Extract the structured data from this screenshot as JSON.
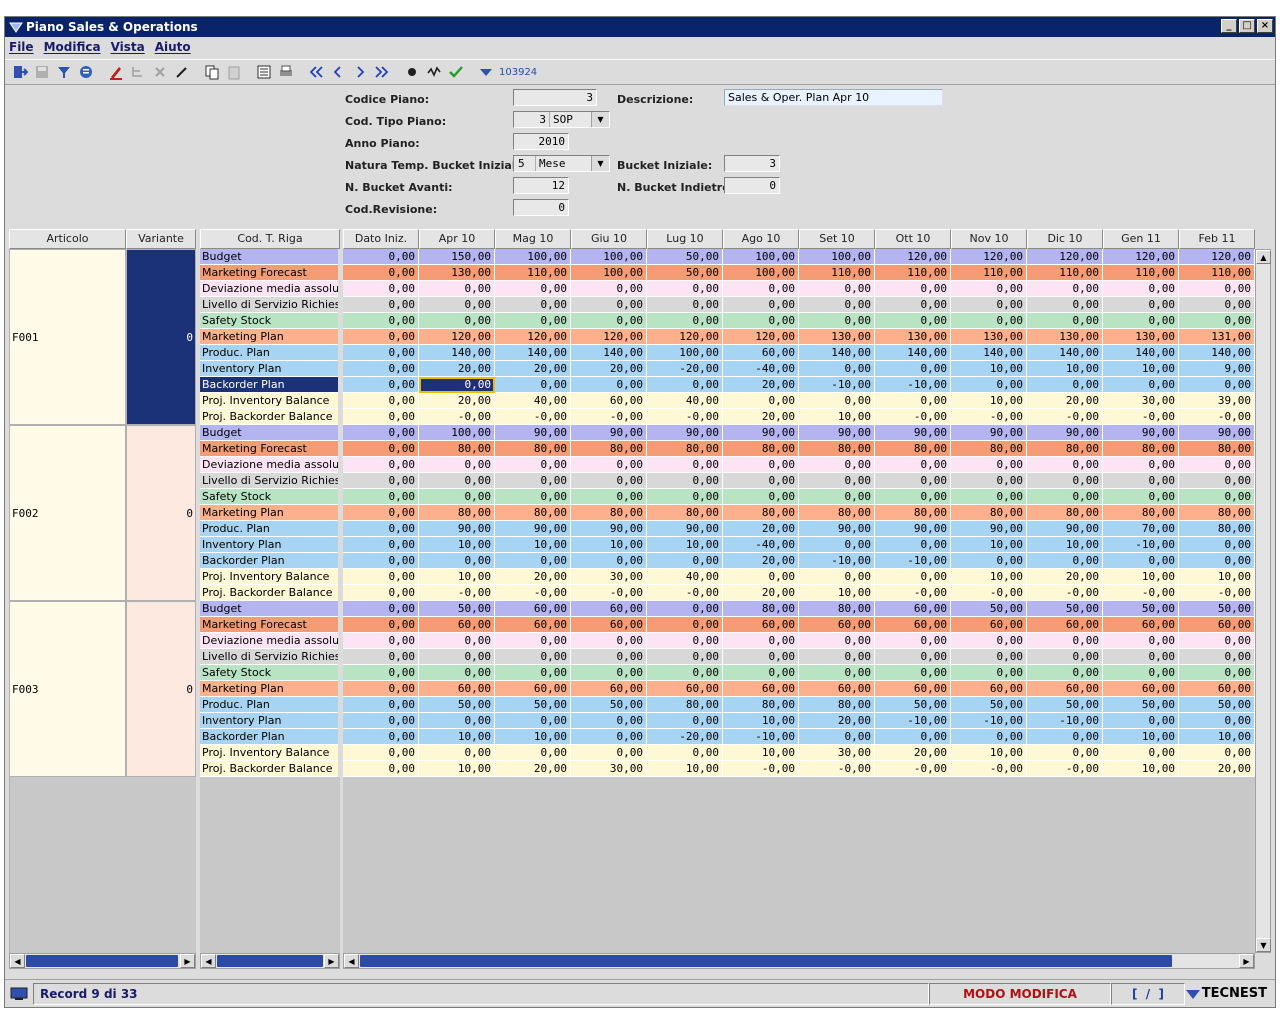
{
  "window": {
    "title": "Piano Sales & Operations"
  },
  "menu": [
    {
      "label": "File"
    },
    {
      "label": "Modifica"
    },
    {
      "label": "Vista"
    },
    {
      "label": "Aiuto"
    }
  ],
  "toolbar": {
    "record_id": "103924"
  },
  "form": {
    "codice_piano": {
      "label": "Codice Piano:",
      "value": "3"
    },
    "descrizione": {
      "label": "Descrizione:",
      "value": "Sales & Oper. Plan Apr 10"
    },
    "cod_tipo_piano": {
      "label": "Cod. Tipo Piano:",
      "code": "3",
      "value": "SOP"
    },
    "anno_piano": {
      "label": "Anno Piano:",
      "value": "2010"
    },
    "natura_temp": {
      "label": "Natura Temp. Bucket Iniziale:",
      "code": "5",
      "value": "Mese"
    },
    "bucket_iniziale": {
      "label": "Bucket Iniziale:",
      "value": "3"
    },
    "n_bucket_avanti": {
      "label": "N. Bucket Avanti:",
      "value": "12"
    },
    "n_bucket_indietro": {
      "label": "N. Bucket Indietro:",
      "value": "0"
    },
    "cod_revisione": {
      "label": "Cod.Revisione:",
      "value": "0"
    }
  },
  "grid": {
    "left_headers": {
      "articolo": "Articolo",
      "variante": "Variante",
      "cod_riga": "Cod. T. Riga"
    },
    "columns": [
      "Dato Iniz.",
      "Apr 10",
      "Mag 10",
      "Giu 10",
      "Lug 10",
      "Ago 10",
      "Set 10",
      "Ott 10",
      "Nov 10",
      "Dic 10",
      "Gen 11",
      "Feb 11"
    ],
    "row_colors": {
      "Budget": "#b4b4f0",
      "Marketing Forecast": "#f59c74",
      "Deviazione media assoluta": "#fce4f4",
      "Livello di Servizio Richiesto": "#d8d8d8",
      "Safety Stock": "#b8e4c4",
      "Marketing Plan": "#fcb08c",
      "Produc. Plan": "#a8d4f4",
      "Inventory Plan": "#a8d4f4",
      "Backorder Plan": "#a8d4f4",
      "Proj. Inventory Balance": "#fff8d4",
      "Proj. Backorder Balance": "#fff8d4"
    },
    "selected_color": "#1c3278",
    "articles": [
      {
        "code": "F001",
        "variant": "0",
        "rows": [
          {
            "label": "Budget",
            "values": [
              "0,00",
              "150,00",
              "100,00",
              "100,00",
              "50,00",
              "100,00",
              "100,00",
              "120,00",
              "120,00",
              "120,00",
              "120,00",
              "120,00"
            ]
          },
          {
            "label": "Marketing Forecast",
            "values": [
              "0,00",
              "130,00",
              "110,00",
              "100,00",
              "50,00",
              "100,00",
              "110,00",
              "110,00",
              "110,00",
              "110,00",
              "110,00",
              "110,00"
            ]
          },
          {
            "label": "Deviazione media assoluta",
            "values": [
              "0,00",
              "0,00",
              "0,00",
              "0,00",
              "0,00",
              "0,00",
              "0,00",
              "0,00",
              "0,00",
              "0,00",
              "0,00",
              "0,00"
            ]
          },
          {
            "label": "Livello di Servizio Richiesto",
            "values": [
              "0,00",
              "0,00",
              "0,00",
              "0,00",
              "0,00",
              "0,00",
              "0,00",
              "0,00",
              "0,00",
              "0,00",
              "0,00",
              "0,00"
            ]
          },
          {
            "label": "Safety Stock",
            "values": [
              "0,00",
              "0,00",
              "0,00",
              "0,00",
              "0,00",
              "0,00",
              "0,00",
              "0,00",
              "0,00",
              "0,00",
              "0,00",
              "0,00"
            ]
          },
          {
            "label": "Marketing Plan",
            "values": [
              "0,00",
              "120,00",
              "120,00",
              "120,00",
              "120,00",
              "120,00",
              "130,00",
              "130,00",
              "130,00",
              "130,00",
              "130,00",
              "131,00"
            ]
          },
          {
            "label": "Produc. Plan",
            "values": [
              "0,00",
              "140,00",
              "140,00",
              "140,00",
              "100,00",
              "60,00",
              "140,00",
              "140,00",
              "140,00",
              "140,00",
              "140,00",
              "140,00"
            ]
          },
          {
            "label": "Inventory Plan",
            "values": [
              "0,00",
              "20,00",
              "20,00",
              "20,00",
              "-20,00",
              "-40,00",
              "0,00",
              "0,00",
              "10,00",
              "10,00",
              "10,00",
              "9,00"
            ]
          },
          {
            "label": "Backorder Plan",
            "values": [
              "0,00",
              "0,00",
              "0,00",
              "0,00",
              "0,00",
              "20,00",
              "-10,00",
              "-10,00",
              "0,00",
              "0,00",
              "0,00",
              "0,00"
            ]
          },
          {
            "label": "Proj. Inventory Balance",
            "values": [
              "0,00",
              "20,00",
              "40,00",
              "60,00",
              "40,00",
              "0,00",
              "0,00",
              "0,00",
              "10,00",
              "20,00",
              "30,00",
              "39,00"
            ]
          },
          {
            "label": "Proj. Backorder Balance",
            "values": [
              "0,00",
              "-0,00",
              "-0,00",
              "-0,00",
              "-0,00",
              "20,00",
              "10,00",
              "-0,00",
              "-0,00",
              "-0,00",
              "-0,00",
              "-0,00"
            ]
          }
        ]
      },
      {
        "code": "F002",
        "variant": "0",
        "rows": [
          {
            "label": "Budget",
            "values": [
              "0,00",
              "100,00",
              "90,00",
              "90,00",
              "90,00",
              "90,00",
              "90,00",
              "90,00",
              "90,00",
              "90,00",
              "90,00",
              "90,00"
            ]
          },
          {
            "label": "Marketing Forecast",
            "values": [
              "0,00",
              "80,00",
              "80,00",
              "80,00",
              "80,00",
              "80,00",
              "80,00",
              "80,00",
              "80,00",
              "80,00",
              "80,00",
              "80,00"
            ]
          },
          {
            "label": "Deviazione media assoluta",
            "values": [
              "0,00",
              "0,00",
              "0,00",
              "0,00",
              "0,00",
              "0,00",
              "0,00",
              "0,00",
              "0,00",
              "0,00",
              "0,00",
              "0,00"
            ]
          },
          {
            "label": "Livello di Servizio Richiesto",
            "values": [
              "0,00",
              "0,00",
              "0,00",
              "0,00",
              "0,00",
              "0,00",
              "0,00",
              "0,00",
              "0,00",
              "0,00",
              "0,00",
              "0,00"
            ]
          },
          {
            "label": "Safety Stock",
            "values": [
              "0,00",
              "0,00",
              "0,00",
              "0,00",
              "0,00",
              "0,00",
              "0,00",
              "0,00",
              "0,00",
              "0,00",
              "0,00",
              "0,00"
            ]
          },
          {
            "label": "Marketing Plan",
            "values": [
              "0,00",
              "80,00",
              "80,00",
              "80,00",
              "80,00",
              "80,00",
              "80,00",
              "80,00",
              "80,00",
              "80,00",
              "80,00",
              "80,00"
            ]
          },
          {
            "label": "Produc. Plan",
            "values": [
              "0,00",
              "90,00",
              "90,00",
              "90,00",
              "90,00",
              "20,00",
              "90,00",
              "90,00",
              "90,00",
              "90,00",
              "70,00",
              "80,00"
            ]
          },
          {
            "label": "Inventory Plan",
            "values": [
              "0,00",
              "10,00",
              "10,00",
              "10,00",
              "10,00",
              "-40,00",
              "0,00",
              "0,00",
              "10,00",
              "10,00",
              "-10,00",
              "0,00"
            ]
          },
          {
            "label": "Backorder Plan",
            "values": [
              "0,00",
              "0,00",
              "0,00",
              "0,00",
              "0,00",
              "20,00",
              "-10,00",
              "-10,00",
              "0,00",
              "0,00",
              "0,00",
              "0,00"
            ]
          },
          {
            "label": "Proj. Inventory Balance",
            "values": [
              "0,00",
              "10,00",
              "20,00",
              "30,00",
              "40,00",
              "0,00",
              "0,00",
              "0,00",
              "10,00",
              "20,00",
              "10,00",
              "10,00"
            ]
          },
          {
            "label": "Proj. Backorder Balance",
            "values": [
              "0,00",
              "-0,00",
              "-0,00",
              "-0,00",
              "-0,00",
              "20,00",
              "10,00",
              "-0,00",
              "-0,00",
              "-0,00",
              "-0,00",
              "-0,00"
            ]
          }
        ]
      },
      {
        "code": "F003",
        "variant": "0",
        "rows": [
          {
            "label": "Budget",
            "values": [
              "0,00",
              "50,00",
              "60,00",
              "60,00",
              "0,00",
              "80,00",
              "80,00",
              "60,00",
              "50,00",
              "50,00",
              "50,00",
              "50,00"
            ]
          },
          {
            "label": "Marketing Forecast",
            "values": [
              "0,00",
              "60,00",
              "60,00",
              "60,00",
              "0,00",
              "60,00",
              "60,00",
              "60,00",
              "60,00",
              "60,00",
              "60,00",
              "60,00"
            ]
          },
          {
            "label": "Deviazione media assoluta",
            "values": [
              "0,00",
              "0,00",
              "0,00",
              "0,00",
              "0,00",
              "0,00",
              "0,00",
              "0,00",
              "0,00",
              "0,00",
              "0,00",
              "0,00"
            ]
          },
          {
            "label": "Livello di Servizio Richiesto",
            "values": [
              "0,00",
              "0,00",
              "0,00",
              "0,00",
              "0,00",
              "0,00",
              "0,00",
              "0,00",
              "0,00",
              "0,00",
              "0,00",
              "0,00"
            ]
          },
          {
            "label": "Safety Stock",
            "values": [
              "0,00",
              "0,00",
              "0,00",
              "0,00",
              "0,00",
              "0,00",
              "0,00",
              "0,00",
              "0,00",
              "0,00",
              "0,00",
              "0,00"
            ]
          },
          {
            "label": "Marketing Plan",
            "values": [
              "0,00",
              "60,00",
              "60,00",
              "60,00",
              "60,00",
              "60,00",
              "60,00",
              "60,00",
              "60,00",
              "60,00",
              "60,00",
              "60,00"
            ]
          },
          {
            "label": "Produc. Plan",
            "values": [
              "0,00",
              "50,00",
              "50,00",
              "50,00",
              "80,00",
              "80,00",
              "80,00",
              "50,00",
              "50,00",
              "50,00",
              "50,00",
              "50,00"
            ]
          },
          {
            "label": "Inventory Plan",
            "values": [
              "0,00",
              "0,00",
              "0,00",
              "0,00",
              "0,00",
              "10,00",
              "20,00",
              "-10,00",
              "-10,00",
              "-10,00",
              "0,00",
              "0,00"
            ]
          },
          {
            "label": "Backorder Plan",
            "values": [
              "0,00",
              "10,00",
              "10,00",
              "0,00",
              "-20,00",
              "-10,00",
              "0,00",
              "0,00",
              "0,00",
              "0,00",
              "10,00",
              "10,00"
            ]
          },
          {
            "label": "Proj. Inventory Balance",
            "values": [
              "0,00",
              "0,00",
              "0,00",
              "0,00",
              "0,00",
              "10,00",
              "30,00",
              "20,00",
              "10,00",
              "0,00",
              "0,00",
              "0,00"
            ]
          },
          {
            "label": "Proj. Backorder Balance",
            "values": [
              "0,00",
              "10,00",
              "20,00",
              "30,00",
              "10,00",
              "-0,00",
              "-0,00",
              "-0,00",
              "-0,00",
              "-0,00",
              "10,00",
              "20,00"
            ]
          }
        ]
      }
    ]
  },
  "status": {
    "record": "Record 9 di 33",
    "mode": "MODO MODIFICA",
    "pos": "[  /  ]",
    "brand": "TECNEST"
  }
}
